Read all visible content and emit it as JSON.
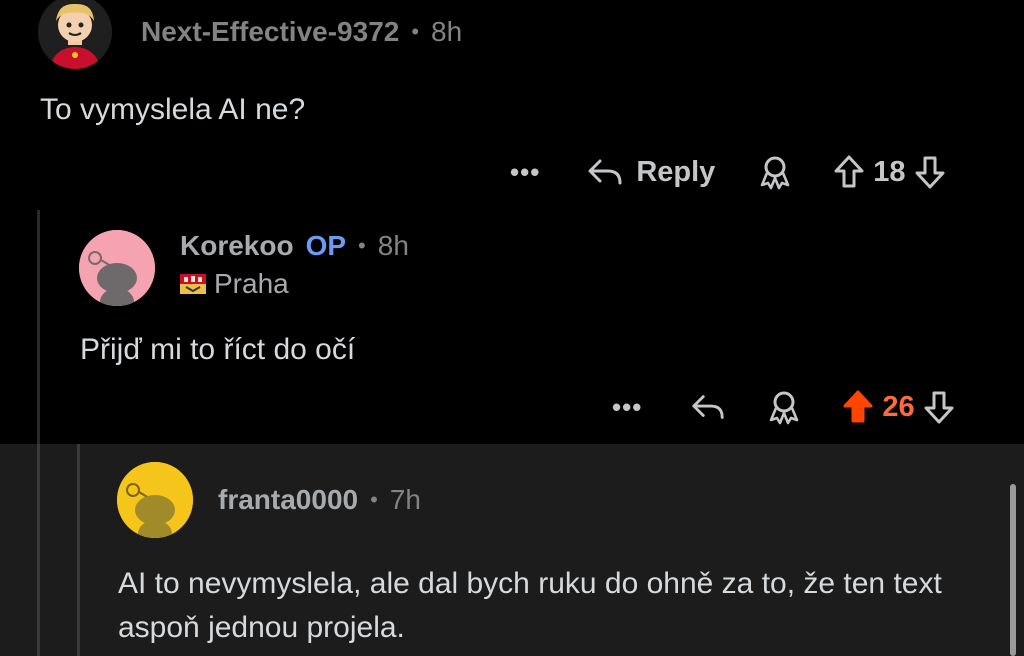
{
  "comments": [
    {
      "author": "Next-Effective-9372",
      "time": "8h",
      "body": "To vymyslela AI ne?",
      "reply_label": "Reply",
      "score": "18",
      "more": "•••"
    },
    {
      "author": "Korekoo",
      "op_badge": "OP",
      "time": "8h",
      "flair": "Praha",
      "body": "Přijď mi to říct do očí",
      "score": "26",
      "more": "•••"
    },
    {
      "author": "franta0000",
      "time": "7h",
      "body": "AI to nevymyslela, ale dal bych ruku do ohně za to, že ten text aspoň jednou projela."
    }
  ],
  "separator": "•",
  "colors": {
    "background": "#000000",
    "highlight": "#1c1c1c",
    "upvote_active": "#ff4500",
    "op_badge": "#6b9cf2",
    "avatar_pink": "#f5a3b1",
    "avatar_yellow": "#f5c51b"
  },
  "icons": [
    "more-icon",
    "reply-icon",
    "award-icon",
    "upvote-icon",
    "downvote-icon",
    "flair-praha-icon",
    "avatar"
  ]
}
